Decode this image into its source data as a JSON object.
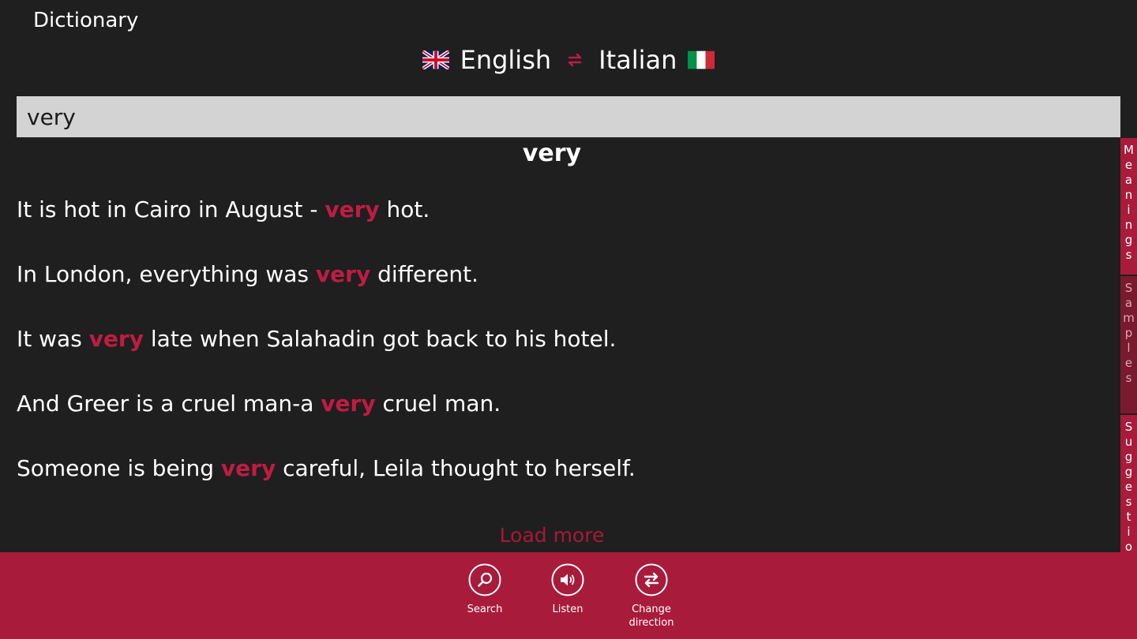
{
  "app": {
    "title": "Dictionary"
  },
  "languages": {
    "from": "English",
    "to": "Italian"
  },
  "search": {
    "value": "very"
  },
  "entry": {
    "headword": "very",
    "highlight_color": "#c01c42",
    "samples": [
      {
        "before": "It is hot in Cairo in August - ",
        "word": "very",
        "after": " hot."
      },
      {
        "before": "In London, everything was ",
        "word": "very",
        "after": " different."
      },
      {
        "before": "It was ",
        "word": "very",
        "after": " late when Salahadin got back to his hotel."
      },
      {
        "before": "And Greer is a cruel man-a ",
        "word": "very",
        "after": " cruel man."
      },
      {
        "before": "Someone is being ",
        "word": "very",
        "after": " careful, Leila thought to herself."
      }
    ],
    "load_more": "Load more"
  },
  "side_tabs": {
    "meanings": "Meanings",
    "samples": "Samples",
    "suggestions": "Suggestio"
  },
  "app_bar": {
    "background": "#a91b3b",
    "search_label": "Search",
    "listen_label": "Listen",
    "change_label": "Change\ndirection"
  },
  "icons": {
    "uk_flag": "uk-flag-icon",
    "italy_flag": "italy-flag-icon",
    "swap": "swap-arrows-icon",
    "search": "search-icon",
    "listen": "speaker-icon",
    "change": "change-direction-icon"
  }
}
